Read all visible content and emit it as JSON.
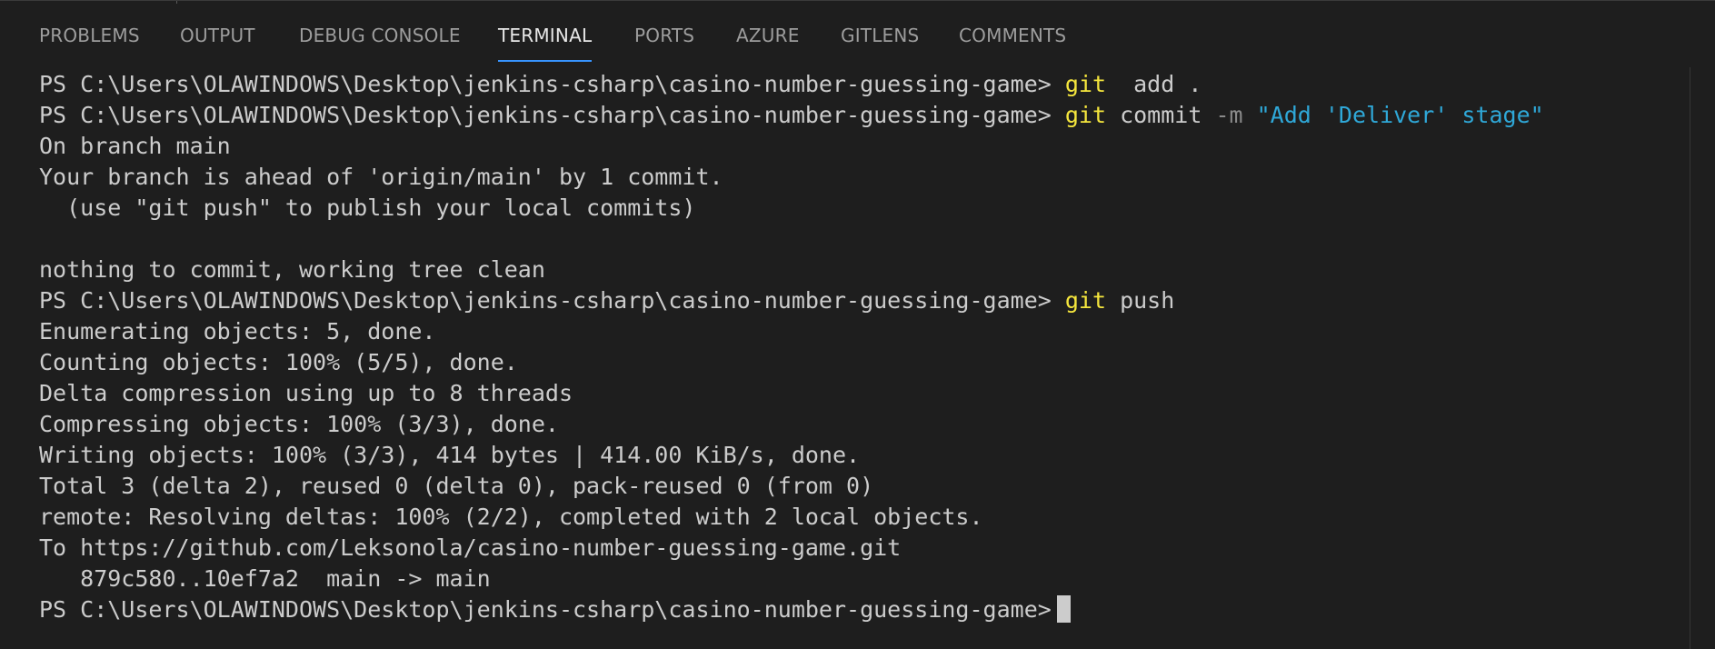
{
  "panel": {
    "tabs": [
      {
        "label": "PROBLEMS"
      },
      {
        "label": "OUTPUT"
      },
      {
        "label": "DEBUG CONSOLE"
      },
      {
        "label": "TERMINAL"
      },
      {
        "label": "PORTS"
      },
      {
        "label": "AZURE"
      },
      {
        "label": "GITLENS"
      },
      {
        "label": "COMMENTS"
      }
    ],
    "active_tab": "TERMINAL",
    "accent_color": "#3794ff"
  },
  "terminal": {
    "prompt": "PS C:\\Users\\OLAWINDOWS\\Desktop\\jenkins-csharp\\casino-number-guessing-game>",
    "cmd1": {
      "git": "git",
      "rest": "  add ."
    },
    "cmd2": {
      "git": "git",
      "sub": " commit",
      "flag": "-m",
      "msg": "\"Add 'Deliver' stage\""
    },
    "out1": [
      "On branch main",
      "Your branch is ahead of 'origin/main' by 1 commit.",
      "  (use \"git push\" to publish your local commits)",
      "",
      "nothing to commit, working tree clean"
    ],
    "cmd3": {
      "git": "git",
      "rest": " push"
    },
    "out2": [
      "Enumerating objects: 5, done.",
      "Counting objects: 100% (5/5), done.",
      "Delta compression using up to 8 threads",
      "Compressing objects: 100% (3/3), done.",
      "Writing objects: 100% (3/3), 414 bytes | 414.00 KiB/s, done.",
      "Total 3 (delta 2), reused 0 (delta 0), pack-reused 0 (from 0)",
      "remote: Resolving deltas: 100% (2/2), completed with 2 local objects.",
      "To https://github.com/Leksonola/casino-number-guessing-game.git",
      "   879c580..10ef7a2  main -> main"
    ],
    "colors": {
      "command": "#f5e63d",
      "string": "#2fa8d8",
      "flag": "#8a8a8a",
      "text": "#cccccc",
      "background": "#1e1e1e"
    }
  }
}
